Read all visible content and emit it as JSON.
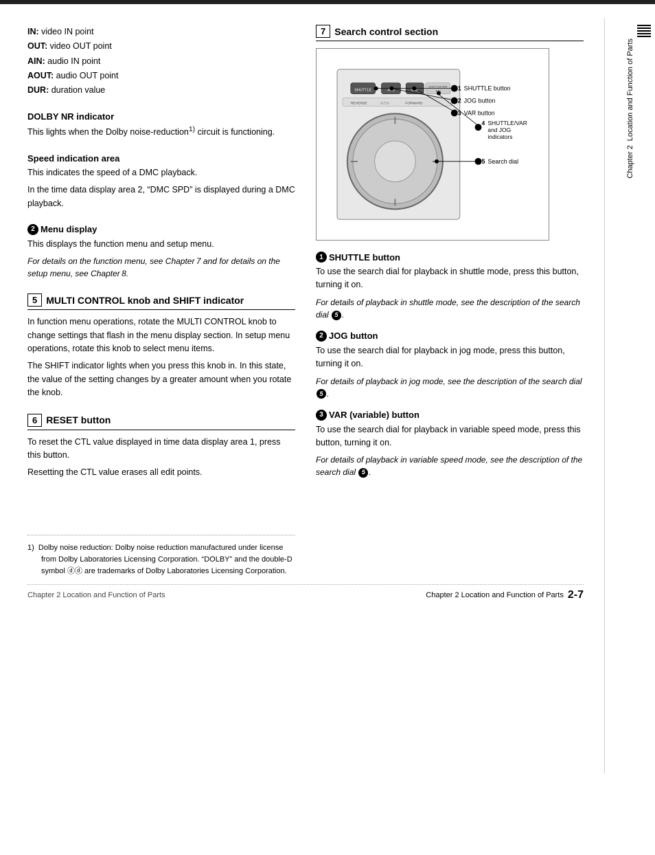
{
  "page": {
    "top_bar_visible": true,
    "chapter_label": "Chapter 2   Location and Function of Parts",
    "page_number": "2-7",
    "bottom_left": "Chapter 2   Location and Function of Parts"
  },
  "left_col": {
    "terms": [
      {
        "key": "IN:",
        "value": "video IN point"
      },
      {
        "key": "OUT:",
        "value": "video OUT point"
      },
      {
        "key": "AIN:",
        "value": "audio IN point"
      },
      {
        "key": "AOUT:",
        "value": "audio OUT point"
      },
      {
        "key": "DUR:",
        "value": "duration value"
      }
    ],
    "dolby_nr": {
      "heading": "DOLBY NR indicator",
      "text": "This lights when the Dolby noise-reduction¹⁾ circuit is functioning."
    },
    "speed_area": {
      "heading": "Speed indication area",
      "text1": "This indicates the speed of a DMC playback.",
      "text2": "In the time data display area 2, “DMC SPD” is displayed during a DMC playback."
    },
    "menu_display": {
      "badge": "2",
      "heading": " Menu display",
      "text": "This displays the function menu and setup menu.",
      "italic": "For details on the function menu, see Chapter 7 and for details on the setup menu, see Chapter 8."
    },
    "section5": {
      "number": "5",
      "heading": "MULTI CONTROL knob and SHIFT indicator",
      "text1": "In function menu operations, rotate the MULTI CONTROL knob to change settings that flash in the menu display section. In setup menu operations, rotate this knob to select menu items.",
      "text2": "The SHIFT indicator lights when you press this knob in. In this state, the value of the setting changes by a greater amount when you rotate the knob."
    },
    "section6": {
      "number": "6",
      "heading": "RESET button",
      "text1": "To reset the CTL value displayed in time data display area 1, press this button.",
      "text2": "Resetting the CTL value erases all edit points."
    }
  },
  "right_col": {
    "section7": {
      "number": "7",
      "heading": "Search control section"
    },
    "diagram_labels": {
      "label1": "① SHUTTLE button",
      "label2": "② JOG button",
      "label3": "③ VAR button",
      "label4": "④ SHUTTLE/VAR and JOG indicators",
      "label5": "⑤ Search dial"
    },
    "shuttle_btn": {
      "badge": "1",
      "heading": " SHUTTLE button",
      "text": "To use the search dial for playback in shuttle mode, press this button, turning it on.",
      "italic": "For details of playback in shuttle mode, see the description of the search dial ⑤."
    },
    "jog_btn": {
      "badge": "2",
      "heading": " JOG button",
      "text": "To use the search dial for playback in jog mode, press this button, turning it on.",
      "italic": "For details of playback in jog mode, see the description of the search dial ⑤."
    },
    "var_btn": {
      "badge": "3",
      "heading": " VAR (variable) button",
      "text": "To use the search dial for playback in variable speed mode, press this button, turning it on.",
      "italic": "For details of playback in variable speed mode, see the description of the search dial ⑤."
    }
  },
  "footnote": {
    "number": "1)",
    "text": "Dolby noise reduction: Dolby noise reduction manufactured under license from Dolby Laboratories Licensing Corporation. “DOLBY” and the double-D symbol ⓓⓓ are trademarks of Dolby Laboratories Licensing Corporation."
  }
}
